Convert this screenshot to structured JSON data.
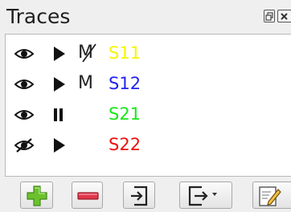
{
  "panel": {
    "title": "Traces",
    "float_icon": "restore-window-icon",
    "close_icon": "close-icon"
  },
  "traces": [
    {
      "name": "S11",
      "color": "#f5f500",
      "visible": true,
      "state": "running",
      "memory": "M",
      "memory_struck": true
    },
    {
      "name": "S12",
      "color": "#2323ee",
      "visible": true,
      "state": "running",
      "memory": "M",
      "memory_struck": false
    },
    {
      "name": "S21",
      "color": "#19e619",
      "visible": true,
      "state": "paused",
      "memory": "",
      "memory_struck": false
    },
    {
      "name": "S22",
      "color": "#ee1111",
      "visible": false,
      "state": "running",
      "memory": "",
      "memory_struck": false
    }
  ],
  "toolbar": {
    "buttons": [
      {
        "name": "add-trace-button",
        "icon": "plus-icon",
        "color": "#6cc12e"
      },
      {
        "name": "remove-trace-button",
        "icon": "minus-icon",
        "color": "#e0374c"
      },
      {
        "name": "import-trace-button",
        "icon": "import-icon"
      },
      {
        "name": "export-trace-button",
        "icon": "export-icon",
        "has_dropdown": true
      },
      {
        "name": "edit-trace-button",
        "icon": "edit-icon"
      }
    ]
  }
}
